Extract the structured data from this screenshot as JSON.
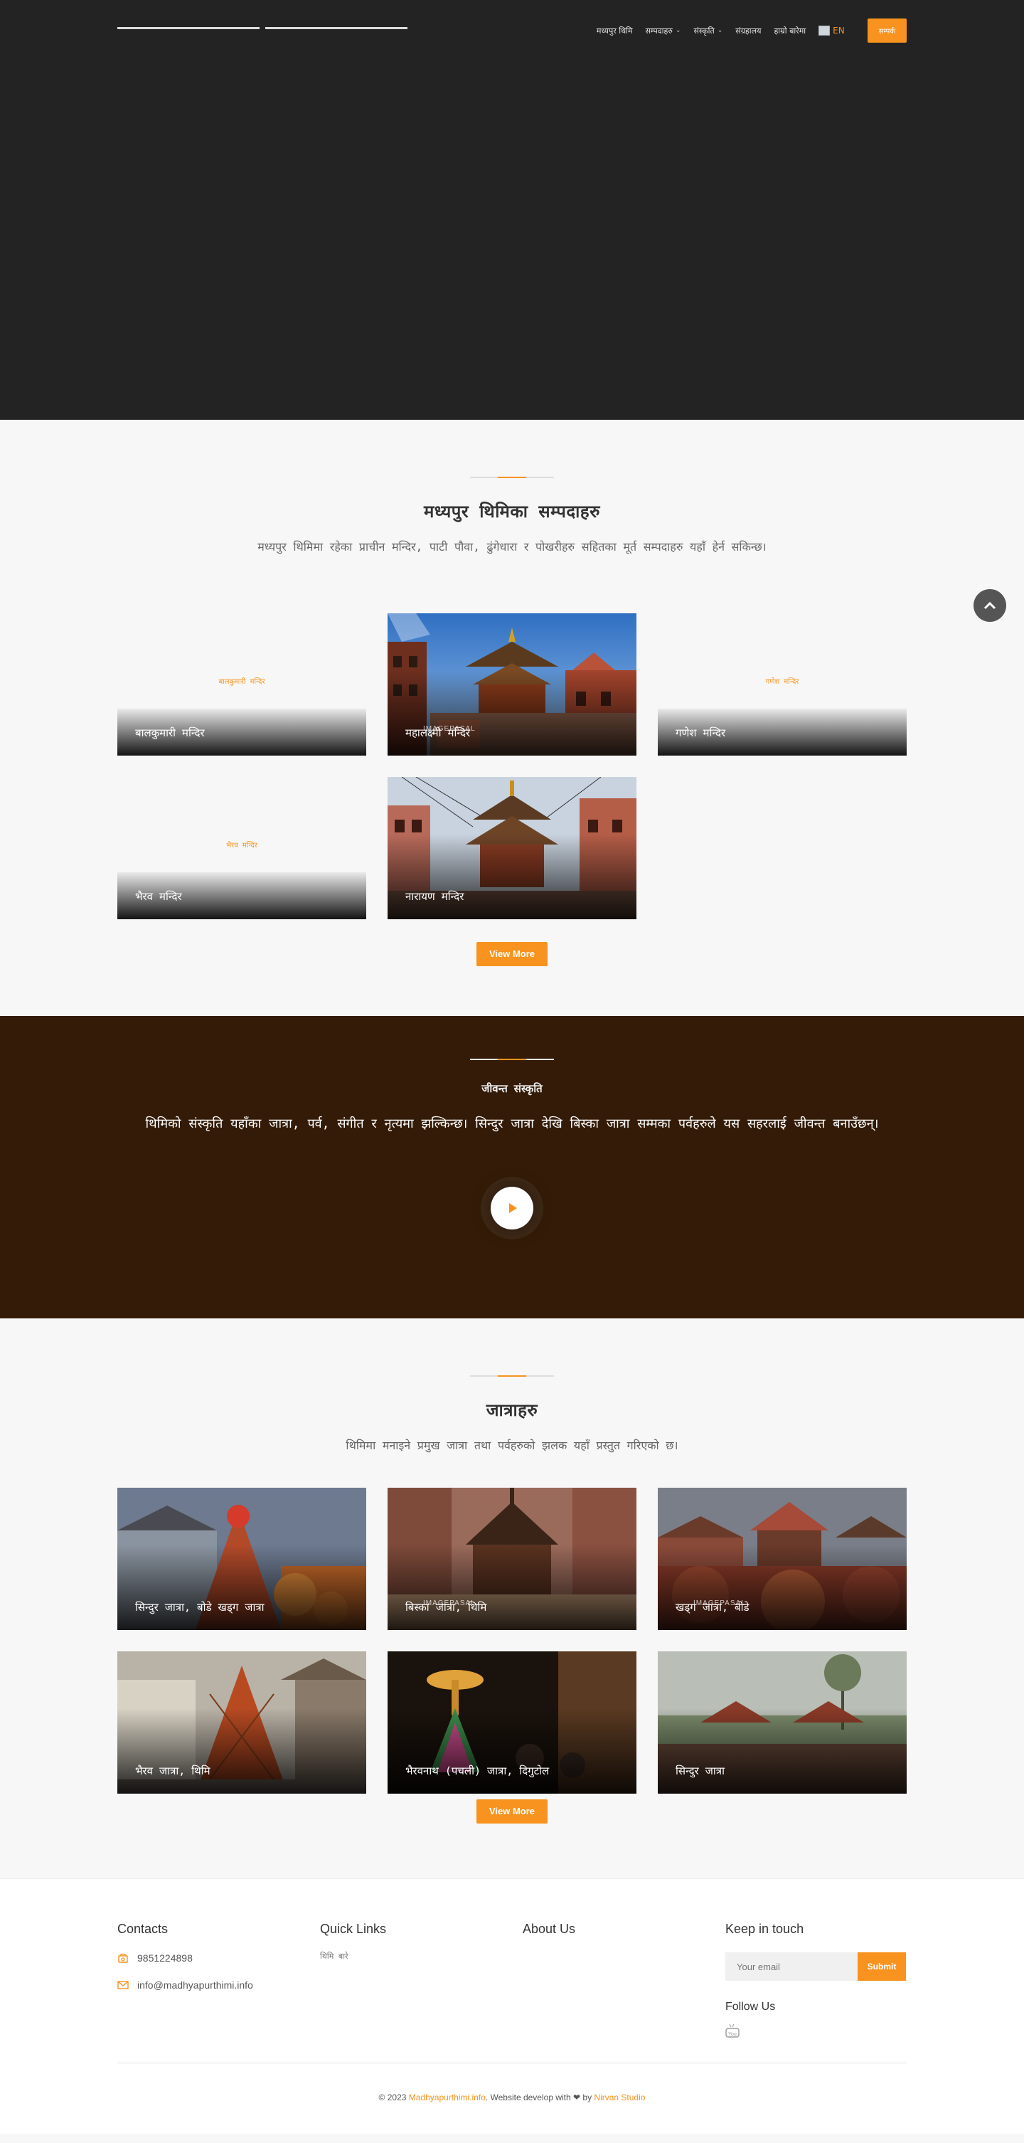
{
  "header": {
    "nav": [
      {
        "label": "मध्यपुर थिमि",
        "dropdown": false
      },
      {
        "label": "सम्पदाहरु",
        "dropdown": true
      },
      {
        "label": "संस्कृति",
        "dropdown": true
      },
      {
        "label": "संग्रहालय",
        "dropdown": false
      },
      {
        "label": "हाम्रो बारेमा",
        "dropdown": false
      }
    ],
    "lang_label": "EN",
    "cta_label": "सम्पर्क"
  },
  "heritage": {
    "title": "मध्यपुर थिमिका सम्पदाहरु",
    "description": "मध्यपुर थिमिमा रहेका प्राचीन मन्दिर, पाटी पौवा, ढुंगेधारा र पोखरीहरु सहितका मूर्त सम्पदाहरु यहाँ हेर्न सकिन्छ।",
    "cards": [
      {
        "caption": "बालकुमारी मन्दिर",
        "alt": "बालकुमारी मन्दिर",
        "has_image": false
      },
      {
        "caption": "महालक्ष्मी मन्दिर",
        "has_image": true,
        "watermark": "IMAGEPASAL"
      },
      {
        "caption": "गणेश मन्दिर",
        "alt": "गणेश मन्दिर",
        "has_image": false
      },
      {
        "caption": "भैरव मन्दिर",
        "alt": "भैरव मन्दिर",
        "has_image": false
      },
      {
        "caption": "नारायण मन्दिर",
        "has_image": true
      }
    ],
    "view_more": "View More"
  },
  "culture": {
    "title": "जीवन्त संस्कृति",
    "quote": "थिमिको संस्कृति यहाँका जात्रा, पर्व, संगीत र नृत्यमा झल्किन्छ। सिन्दुर जात्रा देखि बिस्का जात्रा सम्मका पर्वहरुले यस सहरलाई जीवन्त बनाउँछन्।"
  },
  "festivals": {
    "title": "जात्राहरु",
    "description": "थिमिमा मनाइने प्रमुख जात्रा तथा पर्वहरुको झलक यहाँ प्रस्तुत गरिएको छ।",
    "cards": [
      {
        "caption": "सिन्दुर जात्रा, बोडे खड्ग जात्रा",
        "watermark": ""
      },
      {
        "caption": "बिस्का जात्रा, थिमि",
        "watermark": "IMAGEPASAL"
      },
      {
        "caption": "खड्ग जात्रा, बोडे",
        "watermark": "IMAGEPASAL"
      },
      {
        "caption": "भैरव जात्रा, थिमि",
        "watermark": ""
      },
      {
        "caption": "भैरवनाथ (पचली) जात्रा, दिगुटोल",
        "watermark": ""
      },
      {
        "caption": "सिन्दुर जात्रा",
        "watermark": ""
      }
    ],
    "view_more": "View More"
  },
  "footer": {
    "contacts_title": "Contacts",
    "phone": "9851224898",
    "email": "info@madhyapurthimi.info",
    "quick_links_title": "Quick Links",
    "quick_links": [
      "थिमि बारे"
    ],
    "about_title": "About Us",
    "keep_title": "Keep in touch",
    "email_placeholder": "Your email",
    "submit_label": "Submit",
    "follow_title": "Follow Us",
    "copy_prefix": "© 2023 ",
    "copy_site": "Madhyapurthimi.info",
    "copy_mid": ". Website develop with ❤ by ",
    "copy_studio": "Nirvan Studio"
  },
  "colors": {
    "accent": "#f7931e",
    "hero_bg": "#232323",
    "culture_bg": "#331b07",
    "page_bg": "#f7f7f7"
  },
  "icons": [
    "chevron-down-icon",
    "flag-icon",
    "chevron-up-icon",
    "play-icon",
    "phone-icon",
    "mail-icon",
    "youtube-icon"
  ]
}
